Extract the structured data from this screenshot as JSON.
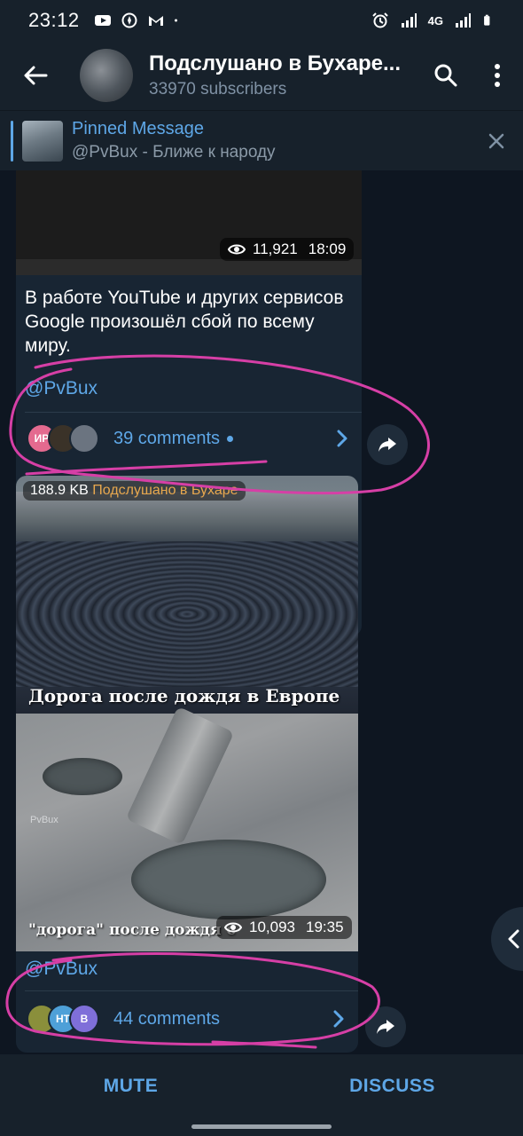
{
  "status_bar": {
    "time": "23:12",
    "network": "4G"
  },
  "header": {
    "title": "Подслушано в Бухаре...",
    "subtitle": "33970 subscribers"
  },
  "pinned": {
    "title": "Pinned Message",
    "handle": "@PvBux",
    "text": " - Ближе к народу"
  },
  "post1": {
    "views": "11,921",
    "time": "18:09",
    "text": "В работе YouTube и других сервисов Google произошёл сбой по всему миру.",
    "handle": "@PvBux",
    "comments": "39 comments",
    "avatar_initials": "ИР"
  },
  "post2": {
    "size_label": "188.9 KB",
    "channel_label": "Подслушано в Бухаре",
    "caption_top": "Дорога после дождя в Европе",
    "caption_bottom": "\"дорога\" после дождя с",
    "watermark": "PvBux",
    "views": "10,093",
    "time": "19:35",
    "handle": "@PvBux",
    "comments": "44 comments",
    "avatar_initials_1": "НТ",
    "avatar_initials_2": "В"
  },
  "bottom_bar": {
    "mute": "MUTE",
    "discuss": "DISCUSS"
  },
  "colors": {
    "accent": "#5ea7e7",
    "background": "#0e1621",
    "bar": "#17212b",
    "bubble": "#182533",
    "annotation": "#d63fa6"
  }
}
